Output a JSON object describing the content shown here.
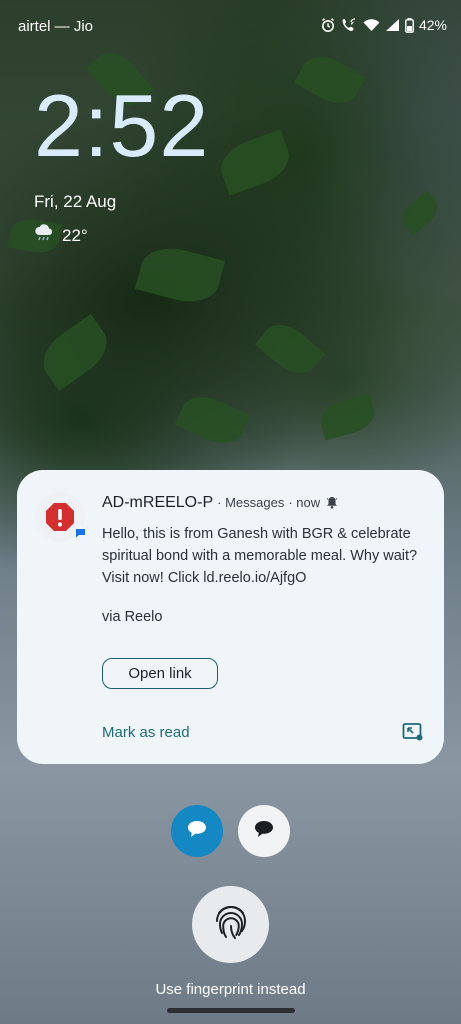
{
  "status_bar": {
    "carrier": "airtel — Jio",
    "battery": "42%",
    "icons": [
      "alarm-icon",
      "wifi-calling-icon",
      "wifi-icon",
      "signal-icon",
      "battery-icon"
    ]
  },
  "lockscreen": {
    "time": "2:52",
    "date": "Fri, 22 Aug",
    "weather_icon": "cloud-rain-icon",
    "temperature": "22°"
  },
  "notification": {
    "app_icon": "alert-octagon-icon",
    "app_badge": "messages-badge-icon",
    "sender": "AD-mREELO-P",
    "app_name": "· Messages",
    "time": "· now",
    "bell_icon": "bell-icon",
    "message": "Hello, this is from Ganesh with BGR & celebrate spiritual bond with a memorable meal. Why wait? Visit now! Click ld.reelo.io/AjfgO",
    "via": "via Reelo",
    "action_open": "Open link",
    "action_mark_read": "Mark as read",
    "expand_icon": "picture-in-picture-icon",
    "accent_color": "#1f6a78",
    "alert_color": "#d32f2f"
  },
  "shortcuts": {
    "left_icon": "chat-bubble-icon",
    "right_icon": "chat-bubble-icon",
    "left_color": "#1488c2"
  },
  "unlock": {
    "fingerprint_icon": "fingerprint-icon",
    "label": "Use fingerprint instead"
  }
}
